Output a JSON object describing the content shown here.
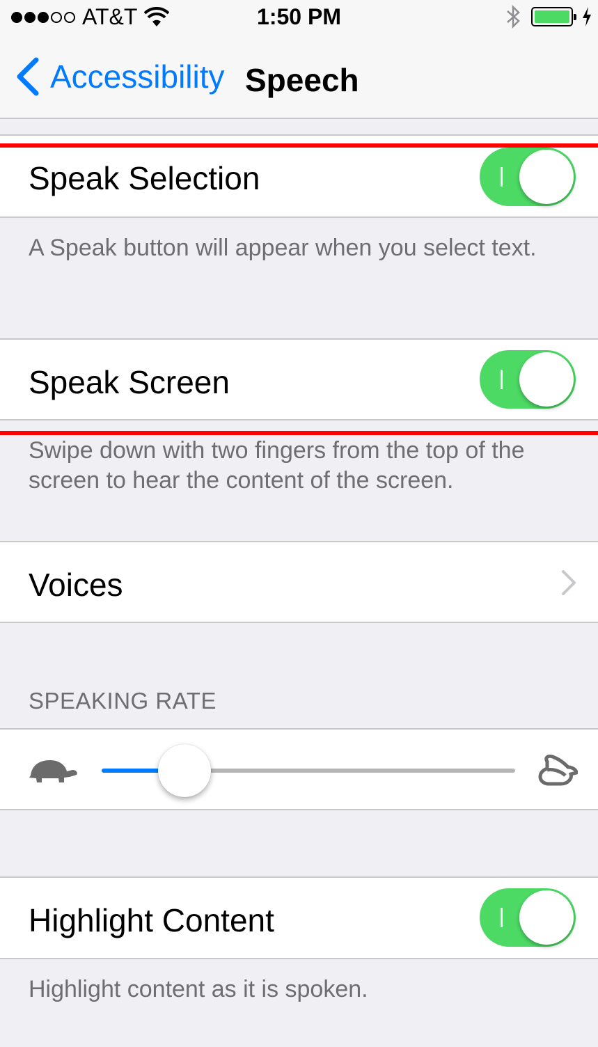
{
  "status_bar": {
    "carrier": "AT&T",
    "time": "1:50 PM",
    "signal_bars_filled": 3,
    "signal_bars_total": 5,
    "battery_level": 1.0
  },
  "nav": {
    "back_label": "Accessibility",
    "title": "Speech"
  },
  "speak_selection": {
    "label": "Speak Selection",
    "enabled": true,
    "footer": "A Speak button will appear when you select text."
  },
  "speak_screen": {
    "label": "Speak Screen",
    "enabled": true,
    "footer": "Swipe down with two fingers from the top of the screen to hear the content of the screen."
  },
  "voices": {
    "label": "Voices"
  },
  "speaking_rate": {
    "header": "SPEAKING RATE",
    "value_fraction": 0.2
  },
  "highlight_content": {
    "label": "Highlight Content",
    "enabled": true,
    "footer": "Highlight content as it is spoken."
  },
  "colors": {
    "accent": "#007aff",
    "toggle_on": "#4cd964",
    "annotation_red": "#ff0000",
    "group_background": "#efeff4",
    "footer_text": "#6d6d72"
  },
  "icons": {
    "back": "chevron-left-icon",
    "voices_disclosure": "chevron-right-icon",
    "rate_min": "turtle-icon",
    "rate_max": "hare-icon",
    "wifi": "wifi-icon",
    "bluetooth": "bluetooth-icon",
    "battery": "battery-icon",
    "charging": "charging-bolt-icon"
  }
}
